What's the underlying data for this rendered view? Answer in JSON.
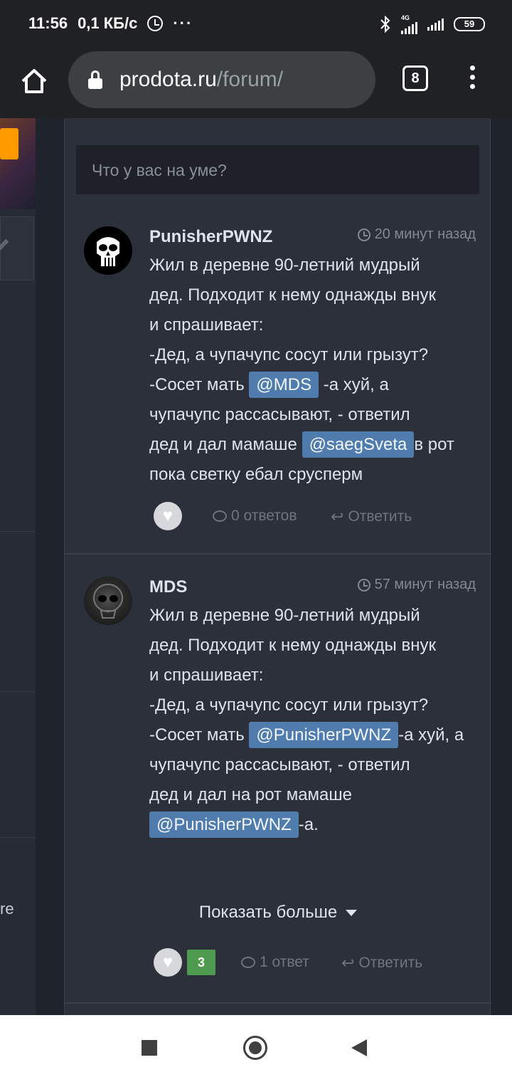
{
  "status_bar": {
    "time": "11:56",
    "speed": "0,1 КБ/с",
    "dots": "···",
    "network": "4G",
    "battery": "59"
  },
  "browser": {
    "url_host": "prodota.ru",
    "url_path": "/forum/",
    "tab_count": "8"
  },
  "compose": {
    "placeholder": "Что у вас на уме?"
  },
  "left_column": {
    "partial_text": "re"
  },
  "posts": [
    {
      "author": "PunisherPWNZ",
      "time": "20 минут назад",
      "text_lines": [
        "Жил в деревне 90-летний мудрый",
        "дед. Подходит к нему однажды внук",
        "и спрашивает:",
        "-Дед, а чупачупс сосут или грызут?"
      ],
      "line5_prefix": "-Сосет мать ",
      "mention1": "@MDS",
      "line5_suffix": " -а хуй, а",
      "line6": "чупачупс рассасывают, - ответил",
      "line7_prefix": "дед и дал мамаше ",
      "mention2": "@saegSveta",
      "line7_suffix": "в рот",
      "line8": "пока светку ебал срусперм",
      "replies": "0 ответов",
      "reply_label": "Ответить"
    },
    {
      "author": "MDS",
      "time": "57 минут назад",
      "text_lines": [
        "Жил в деревне 90-летний мудрый",
        "дед. Подходит к нему однажды внук",
        "и спрашивает:",
        "-Дед, а чупачупс сосут или грызут?"
      ],
      "line5_prefix": "-Сосет мать ",
      "mention1": "@PunisherPWNZ",
      "line5_suffix": "-а хуй, а",
      "line6": "чупачупс рассасывают, - ответил",
      "line7": "дед и дал на рот мамаше",
      "mention2": "@PunisherPWNZ",
      "line8_suffix": "-а.",
      "show_more": "Показать больше",
      "likes": "3",
      "replies": "1 ответ",
      "reply_label": "Ответить"
    }
  ],
  "icons": {
    "home": "home-icon",
    "lock": "lock-icon",
    "menu": "more-vert-icon",
    "like": "heart-icon",
    "clock": "clock-icon",
    "comments": "comment-icon",
    "reply": "reply-icon"
  },
  "colors": {
    "mention_bg": "#4f7cad",
    "like_badge": "#4e9a4e",
    "panel": "#2b303b"
  }
}
